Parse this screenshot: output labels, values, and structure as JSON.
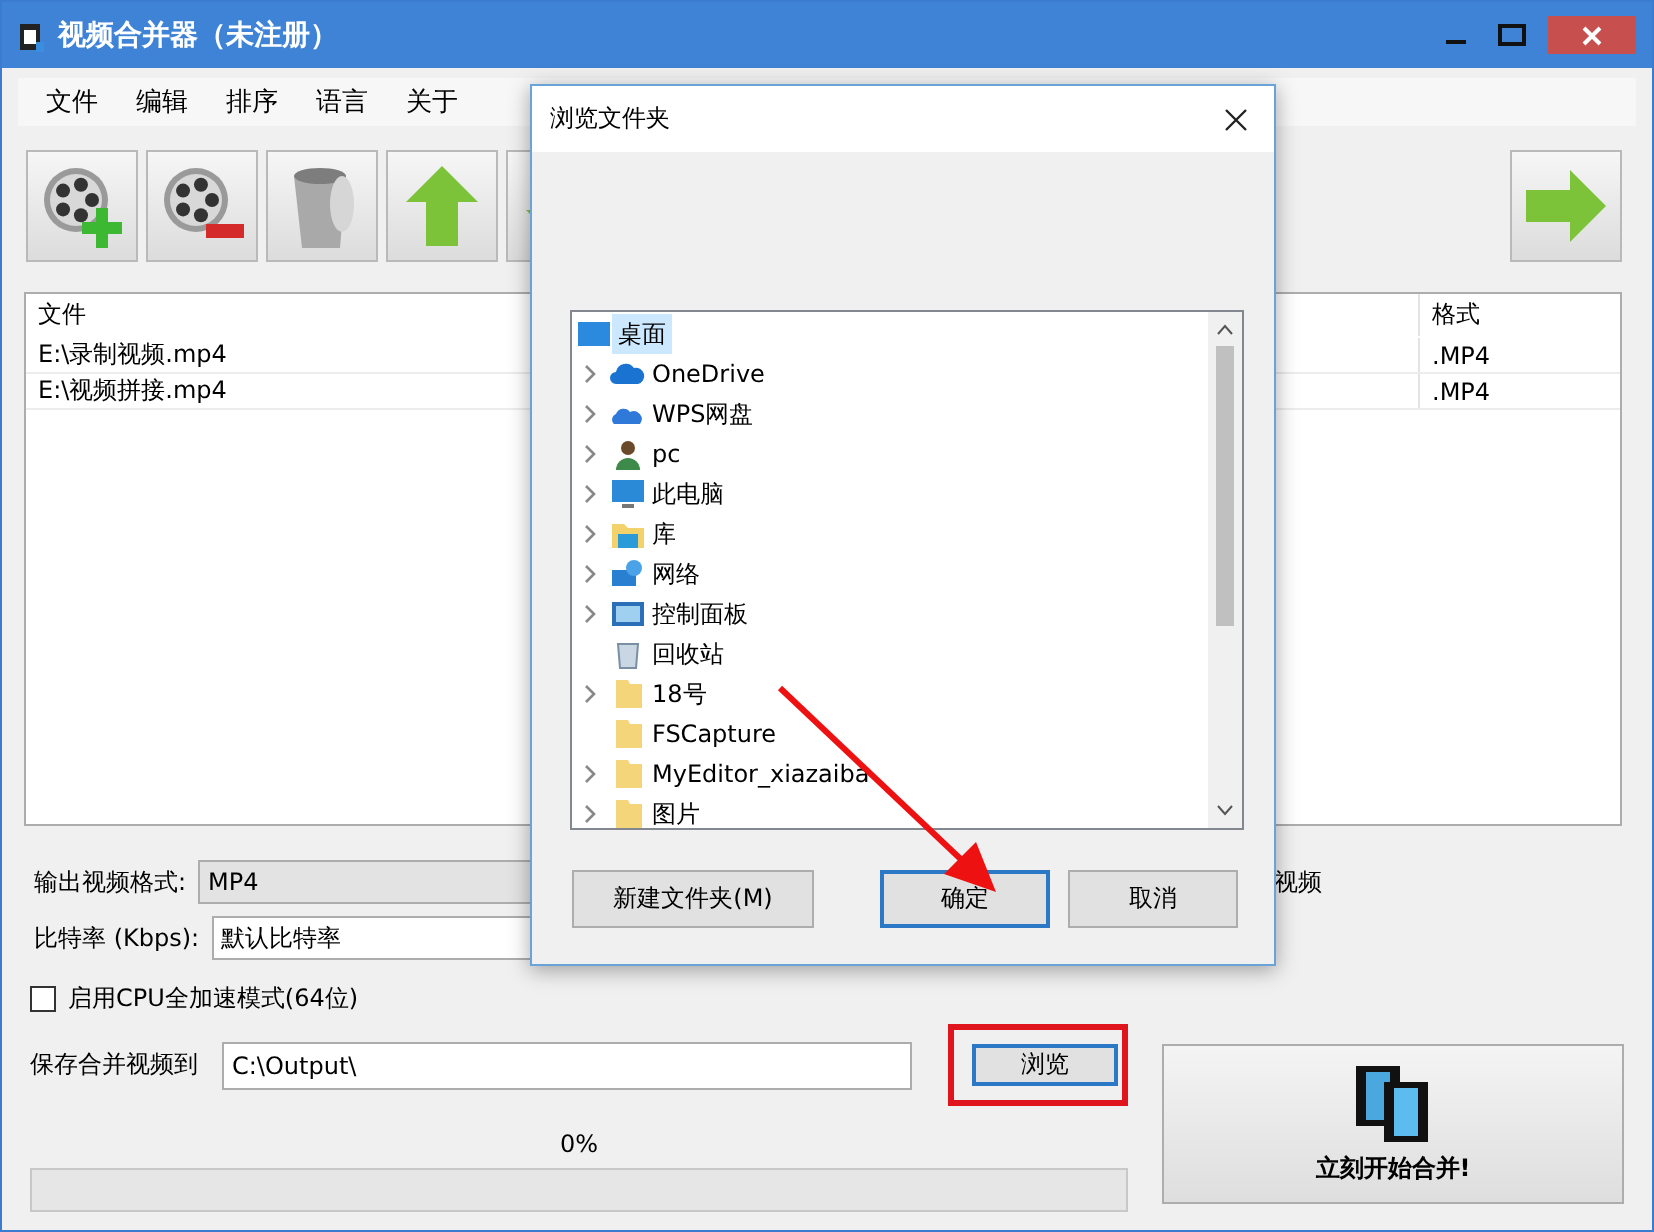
{
  "window": {
    "title": "视频合并器（未注册）"
  },
  "menu": [
    "文件",
    "编辑",
    "排序",
    "语言",
    "关于"
  ],
  "file_list": {
    "columns": [
      "文件",
      "格式"
    ],
    "rows": [
      [
        "E:\\录制视频.mp4",
        ".MP4"
      ],
      [
        "E:\\视频拼接.mp4",
        ".MP4"
      ]
    ]
  },
  "output_format": {
    "label": "输出视频格式:",
    "value": "MP4",
    "side_text": "视频"
  },
  "bitrate": {
    "label": "比特率 (Kbps):",
    "value": "默认比特率"
  },
  "cpu_mode": {
    "label": "启用CPU全加速模式(64位)",
    "checked": false
  },
  "save_to": {
    "label": "保存合并视频到",
    "value": "C:\\Output\\",
    "browse": "浏览"
  },
  "progress": {
    "reading": "0%",
    "level": 0
  },
  "merge_button": "立刻开始合并!",
  "dialog": {
    "title": "浏览文件夹",
    "tree": {
      "label": "桌面",
      "selected": true,
      "children": [
        {
          "label": "OneDrive",
          "kind": "cloud",
          "expandable": true,
          "selected": false
        },
        {
          "label": "WPS网盘",
          "kind": "cloud-pair",
          "expandable": true,
          "selected": false
        },
        {
          "label": "pc",
          "kind": "user",
          "expandable": true,
          "selected": false
        },
        {
          "label": "此电脑",
          "kind": "computer",
          "expandable": true,
          "selected": false
        },
        {
          "label": "库",
          "kind": "library",
          "expandable": true,
          "selected": false
        },
        {
          "label": "网络",
          "kind": "network",
          "expandable": true,
          "selected": false
        },
        {
          "label": "控制面板",
          "kind": "control-panel",
          "expandable": true,
          "selected": false
        },
        {
          "label": "回收站",
          "kind": "recycle-bin",
          "expandable": false,
          "selected": false
        },
        {
          "label": "18号",
          "kind": "folder",
          "expandable": true,
          "selected": false
        },
        {
          "label": "FSCapture",
          "kind": "folder",
          "expandable": false,
          "selected": false
        },
        {
          "label": "MyEditor_xiazaiba",
          "kind": "folder",
          "expandable": true,
          "selected": false
        },
        {
          "label": "图片",
          "kind": "folder",
          "expandable": true,
          "selected": false
        }
      ]
    },
    "buttons": [
      {
        "label": "新建文件夹(M)",
        "default": false
      },
      {
        "label": "确定",
        "default": true
      },
      {
        "label": "取消",
        "default": false
      }
    ]
  }
}
